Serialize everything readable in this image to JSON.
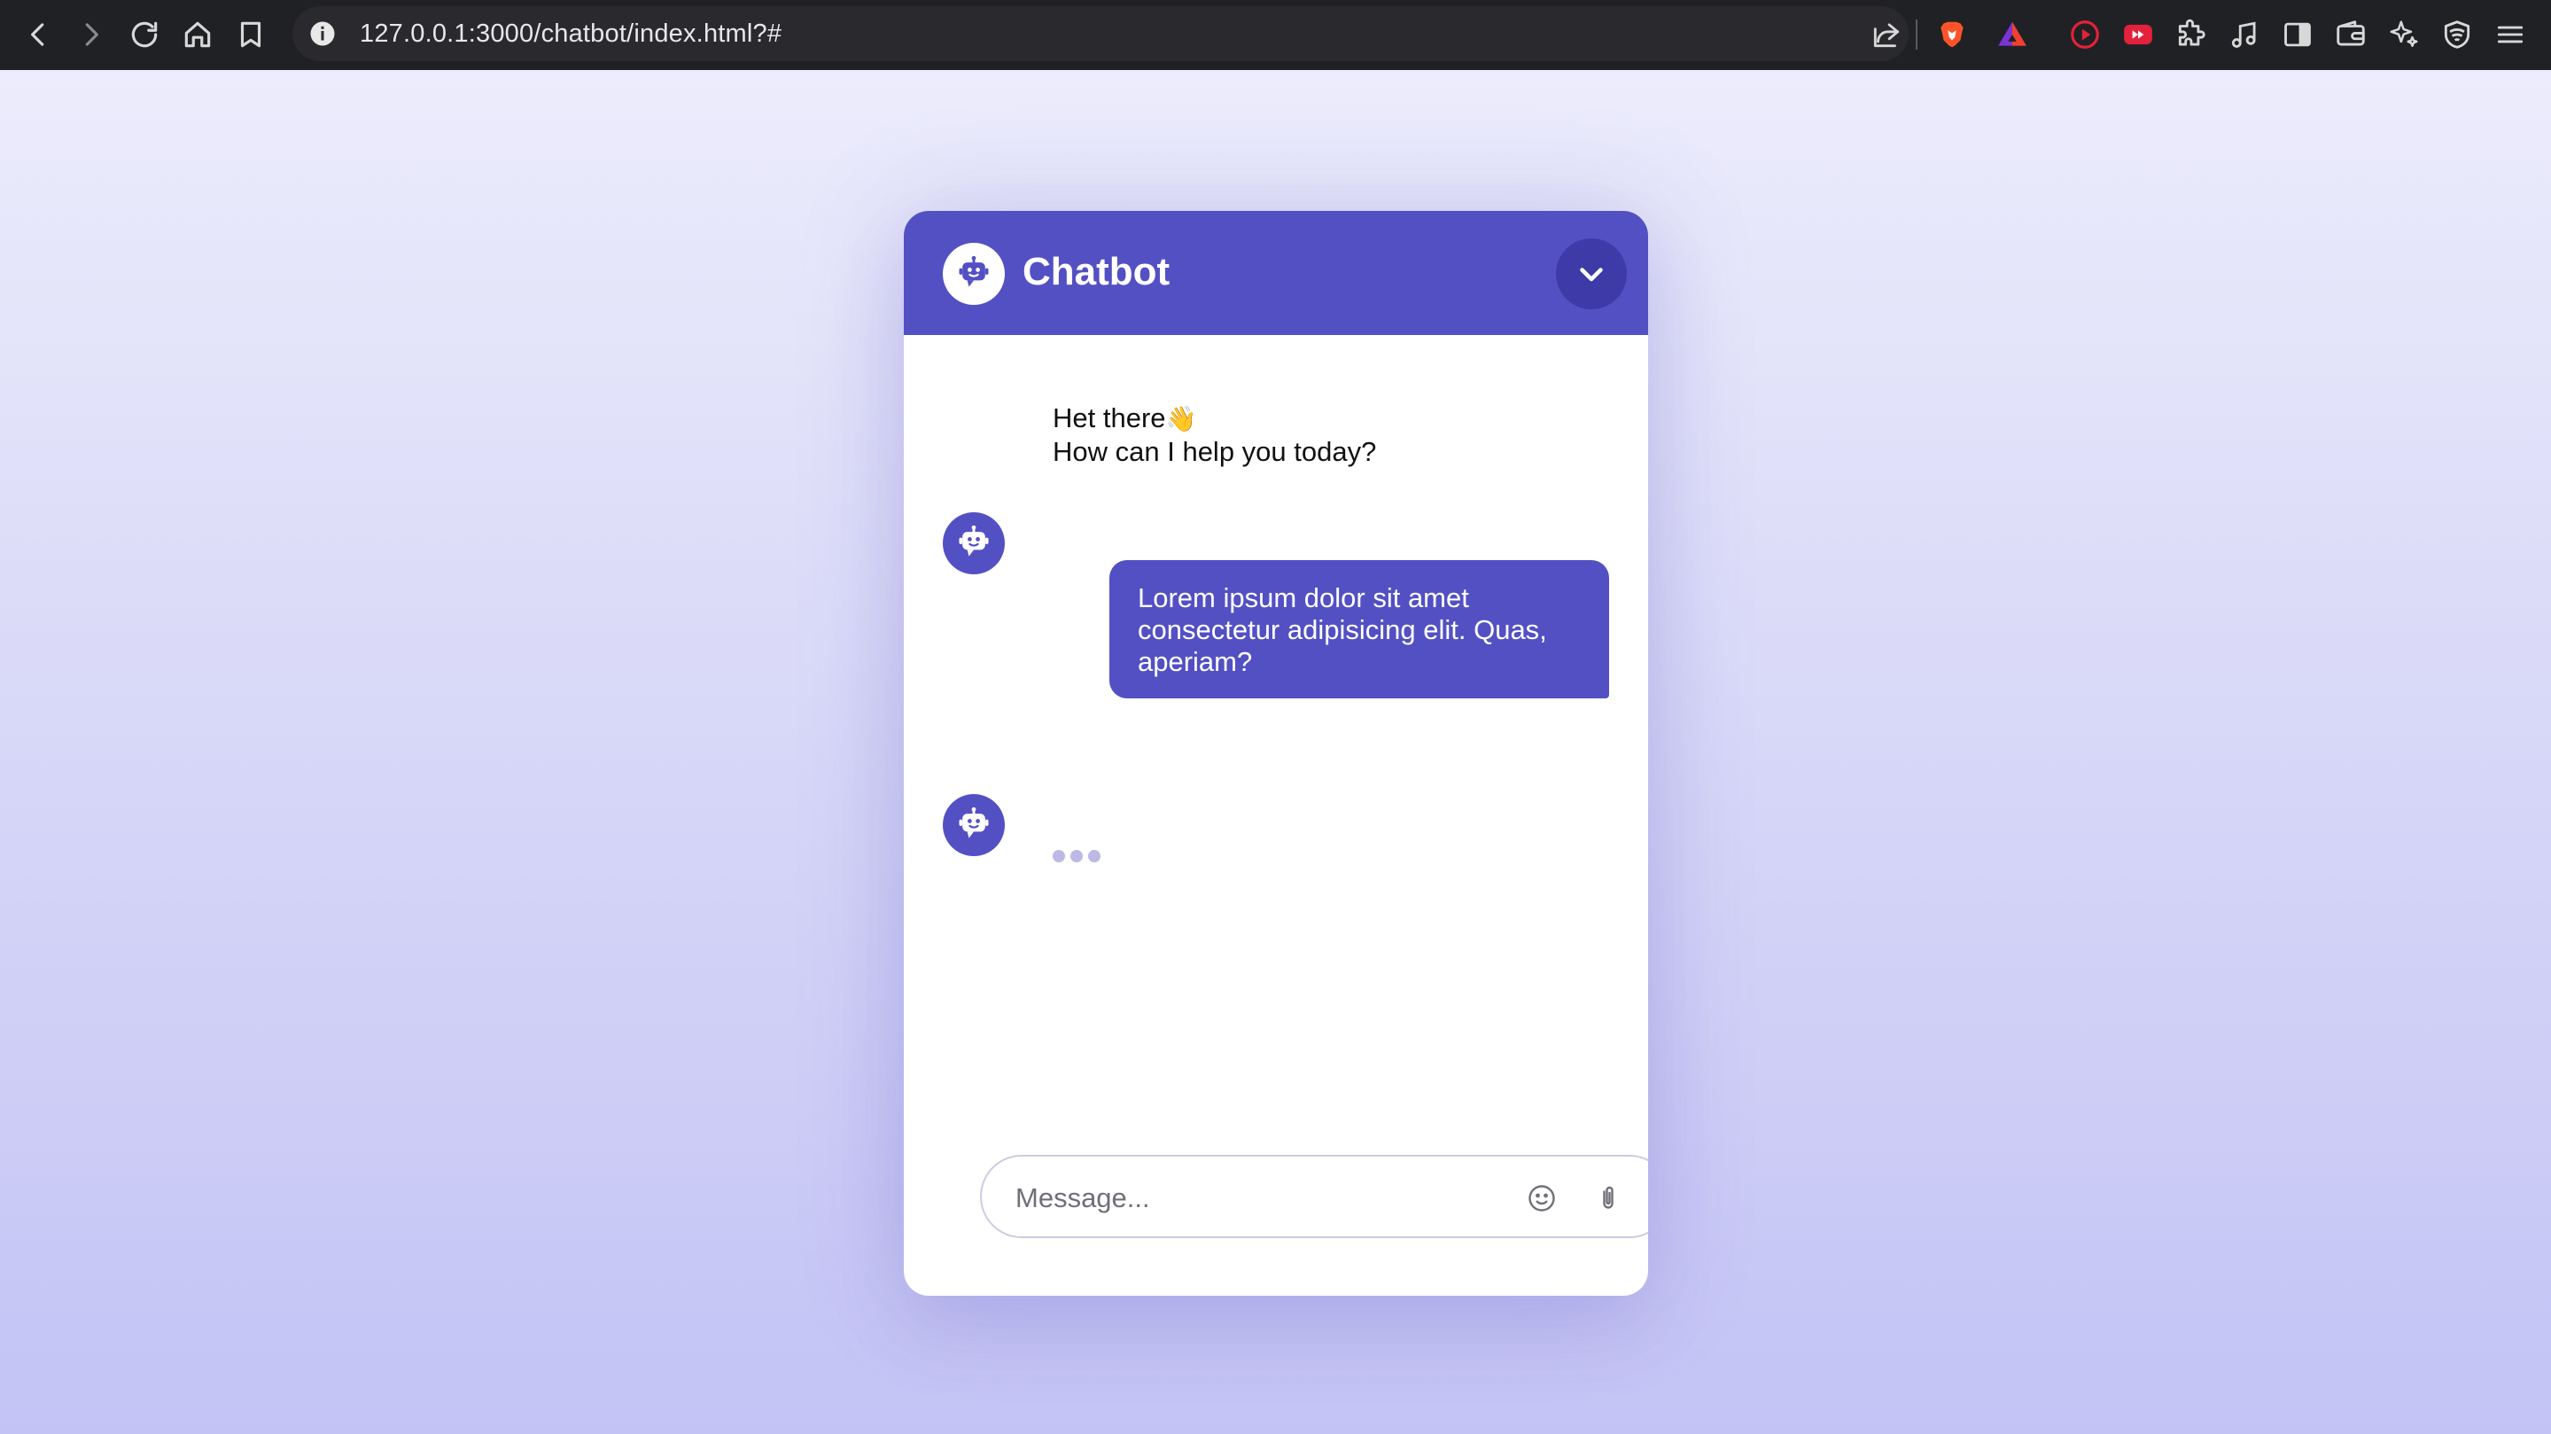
{
  "browser": {
    "url": "127.0.0.1:3000/chatbot/index.html?#",
    "icons": [
      "back-icon",
      "forward-icon",
      "reload-icon",
      "home-icon",
      "bookmark-icon",
      "info-icon",
      "share-icon",
      "brave-shield-icon",
      "brave-rewards-icon",
      "youtube-music-icon",
      "youtube-icon",
      "extensions-icon",
      "media-icon",
      "sidebar-icon",
      "wallet-icon",
      "leo-ai-icon",
      "vpn-icon",
      "menu-icon"
    ]
  },
  "chatbot": {
    "title": "Chatbot",
    "accent_color": "#5350c4",
    "messages": [
      {
        "role": "bot",
        "lines": [
          "Het there",
          "How can I help you today?"
        ],
        "emoji": "👋"
      },
      {
        "role": "user",
        "text": "Lorem ipsum dolor sit amet consectetur adipisicing elit. Quas, aperiam?"
      },
      {
        "role": "bot",
        "typing": true
      }
    ],
    "input": {
      "placeholder": "Message...",
      "value": ""
    }
  }
}
